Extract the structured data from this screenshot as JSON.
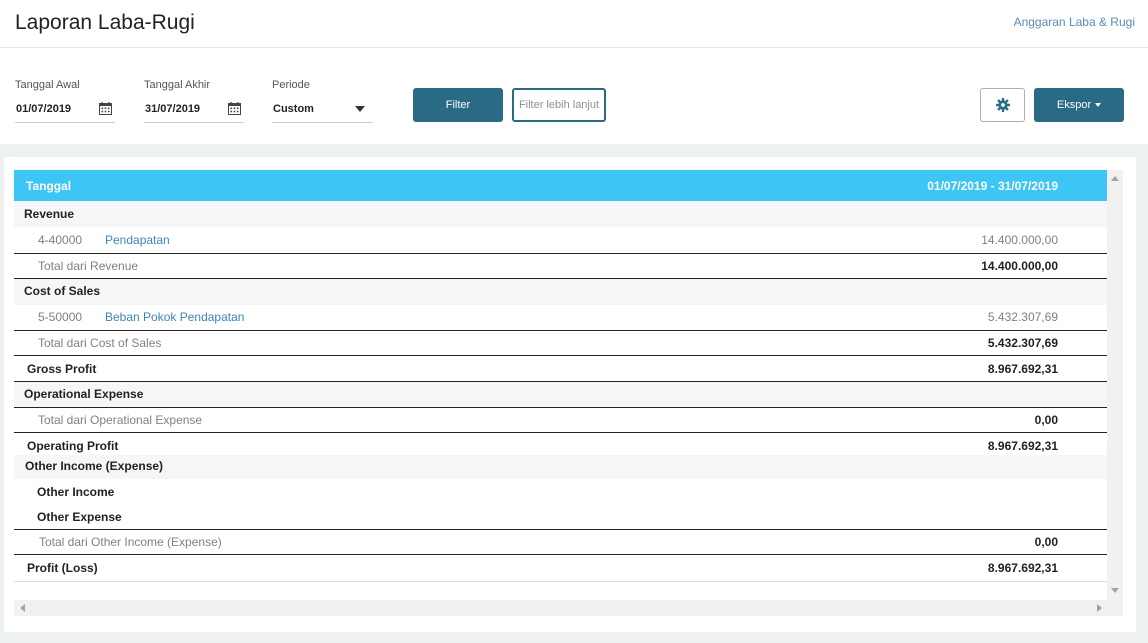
{
  "header": {
    "title": "Laporan Laba-Rugi",
    "link": "Anggaran Laba & Rugi"
  },
  "filters": {
    "start_label": "Tanggal Awal",
    "start_value": "01/07/2019",
    "end_label": "Tanggal Akhir",
    "end_value": "31/07/2019",
    "period_label": "Periode",
    "period_value": "Custom",
    "filter_button": "Filter",
    "advanced_button": "Filter lebih lanjut",
    "export_button": "Ekspor"
  },
  "icons": {
    "calendar": "calendar-icon",
    "gear": "gear-icon",
    "dropdown": "chevron-down-icon"
  },
  "table": {
    "header_col1": "Tanggal",
    "header_col2": "01/07/2019 - 31/07/2019",
    "revenue_label": "Revenue",
    "revenue_account_code": "4-40000",
    "revenue_account_name": "Pendapatan",
    "revenue_account_amount": "14.400.000,00",
    "revenue_total_label": "Total dari Revenue",
    "revenue_total_amount": "14.400.000,00",
    "cos_label": "Cost of Sales",
    "cos_account_code": "5-50000",
    "cos_account_name": "Beban Pokok Pendapatan",
    "cos_account_amount": "5.432.307,69",
    "cos_total_label": "Total dari Cost of Sales",
    "cos_total_amount": "5.432.307,69",
    "gross_profit_label": "Gross Profit",
    "gross_profit_amount": "8.967.692,31",
    "opex_label": "Operational Expense",
    "opex_total_label": "Total dari Operational Expense",
    "opex_total_amount": "0,00",
    "operating_profit_label": "Operating Profit",
    "operating_profit_amount": "8.967.692,31",
    "other_label": "Other Income (Expense)",
    "other_income_label": "Other Income",
    "other_expense_label": "Other Expense",
    "other_total_label": "Total dari Other Income (Expense)",
    "other_total_amount": "0,00",
    "profit_loss_label": "Profit (Loss)",
    "profit_loss_amount": "8.967.692,31"
  },
  "colors": {
    "primary": "#2a6a85",
    "table_header": "#3cc5f5",
    "link": "#3d86b8"
  }
}
